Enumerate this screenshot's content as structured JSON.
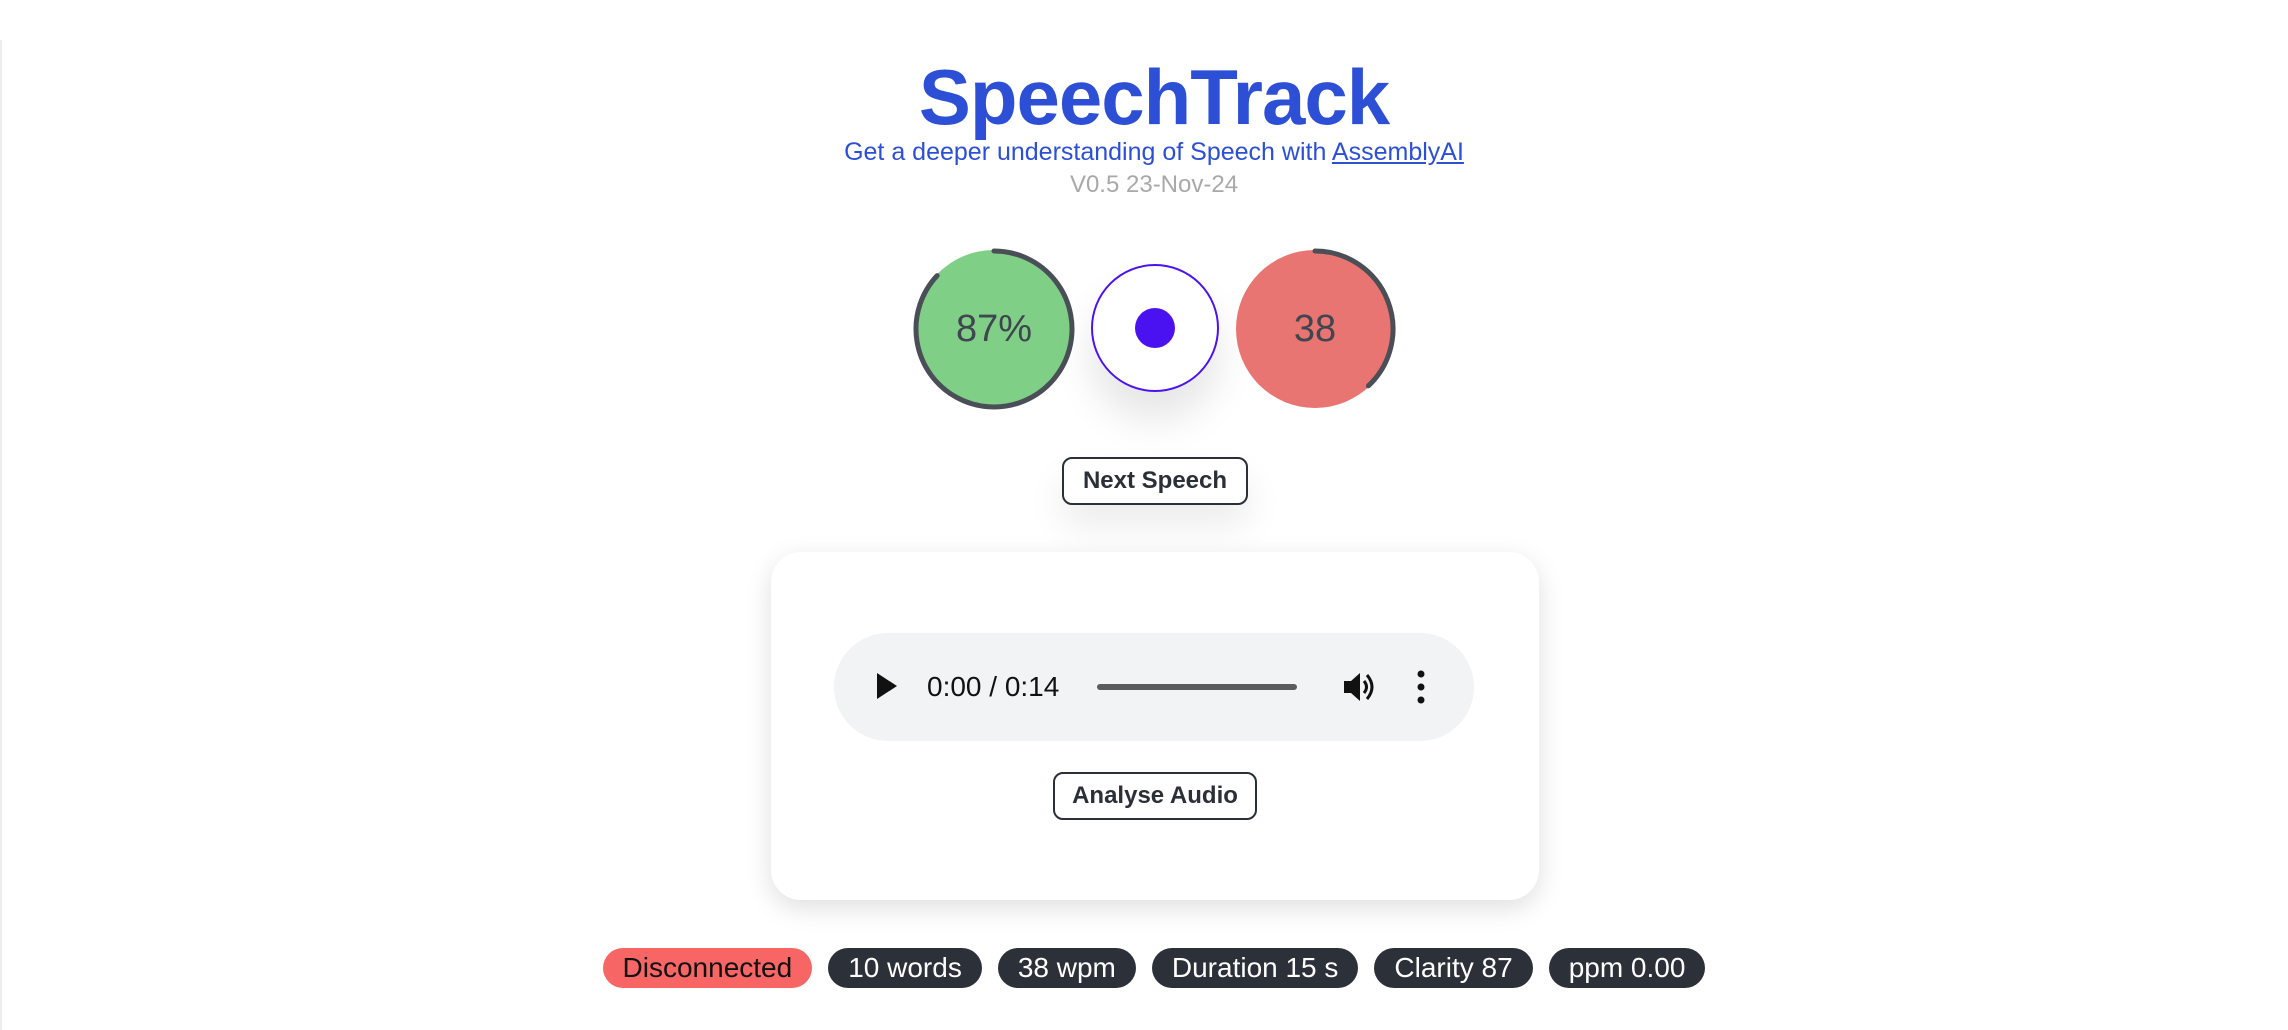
{
  "header": {
    "title": "SpeechTrack",
    "subtitle_prefix": "Get a deeper understanding of Speech with ",
    "subtitle_link": "AssemblyAI",
    "version": "V0.5 23-Nov-24"
  },
  "gauges": {
    "left": {
      "label": "87%",
      "fraction": 0.87,
      "fill_color": "#80cf87",
      "ring_color": "#4a4f57"
    },
    "right": {
      "label": "38",
      "fraction": 0.38,
      "fill_color": "#e87571",
      "ring_color": "#4a4f57"
    }
  },
  "record": {
    "accent_color": "#4a12f0"
  },
  "buttons": {
    "next_speech": "Next Speech",
    "analyse_audio": "Analyse Audio"
  },
  "audio_player": {
    "time": "0:00 / 0:14",
    "progress_fraction": 0.0
  },
  "stats": {
    "status": "Disconnected",
    "words": "10 words",
    "wpm": "38 wpm",
    "duration": "Duration 15 s",
    "clarity": "Clarity 87",
    "ppm": "ppm 0.00"
  },
  "colors": {
    "brand": "#2c4fd6",
    "status_disconnected": "#f76565",
    "badge_bg": "#2c3039"
  }
}
